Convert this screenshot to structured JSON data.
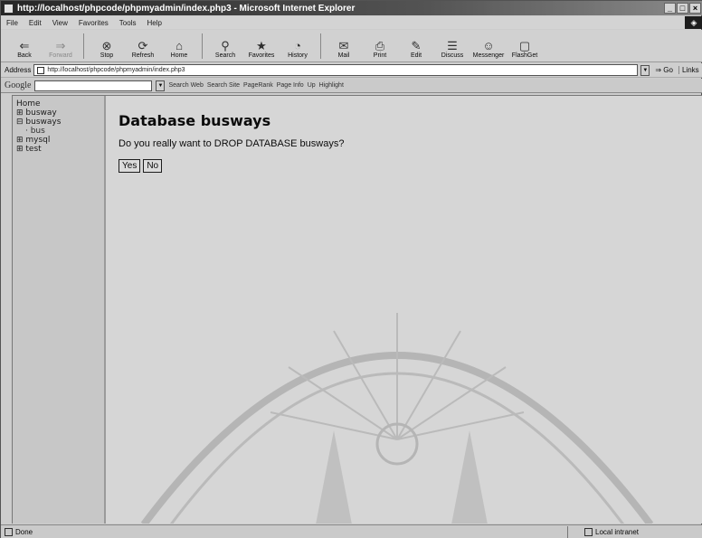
{
  "window": {
    "title": "http://localhost/phpcode/phpmyadmin/index.php3 - Microsoft Internet Explorer",
    "controls": [
      "_",
      "□",
      "×"
    ]
  },
  "menu": [
    "File",
    "Edit",
    "View",
    "Favorites",
    "Tools",
    "Help"
  ],
  "toolbar": [
    {
      "label": "Back",
      "icon": "back-arrow-icon",
      "glyph": "⇐"
    },
    {
      "label": "Forward",
      "icon": "forward-arrow-icon",
      "glyph": "⇒",
      "disabled": true
    },
    {
      "label": "Stop",
      "icon": "stop-icon",
      "glyph": "⊗"
    },
    {
      "label": "Refresh",
      "icon": "refresh-icon",
      "glyph": "⟳"
    },
    {
      "label": "Home",
      "icon": "home-icon",
      "glyph": "⌂"
    },
    {
      "label": "Search",
      "icon": "search-icon",
      "glyph": "⚲"
    },
    {
      "label": "Favorites",
      "icon": "favorites-icon",
      "glyph": "★"
    },
    {
      "label": "History",
      "icon": "history-icon",
      "glyph": "◔"
    },
    {
      "label": "Mail",
      "icon": "mail-icon",
      "glyph": "✉"
    },
    {
      "label": "Print",
      "icon": "print-icon",
      "glyph": "⎙"
    },
    {
      "label": "Edit",
      "icon": "edit-icon",
      "glyph": "✎"
    },
    {
      "label": "Discuss",
      "icon": "discuss-icon",
      "glyph": "☰"
    },
    {
      "label": "Messenger",
      "icon": "messenger-icon",
      "glyph": "☺"
    },
    {
      "label": "FlashGet",
      "icon": "flashget-icon",
      "glyph": "▢"
    }
  ],
  "address": {
    "label": "Address",
    "url": "http://localhost/phpcode/phpmyadmin/index.php3",
    "go_label": "Go",
    "links_label": "Links"
  },
  "google_bar": {
    "logo": "Google",
    "items": [
      "Search Web",
      "Search Site",
      "PageRank",
      "Page Info",
      "Up",
      "Highlight"
    ]
  },
  "left_nav": {
    "home": "Home",
    "items": [
      {
        "label": "⊞ busway"
      },
      {
        "label": "⊟ busways"
      },
      {
        "label": "· bus",
        "sub": true
      },
      {
        "label": "⊞ mysql"
      },
      {
        "label": "⊞ test"
      }
    ]
  },
  "main": {
    "title": "Database busways",
    "question": "Do you really want to DROP DATABASE busways?",
    "yes_label": "Yes",
    "no_label": "No"
  },
  "status": {
    "text": "Done",
    "zone": "Local intranet"
  }
}
